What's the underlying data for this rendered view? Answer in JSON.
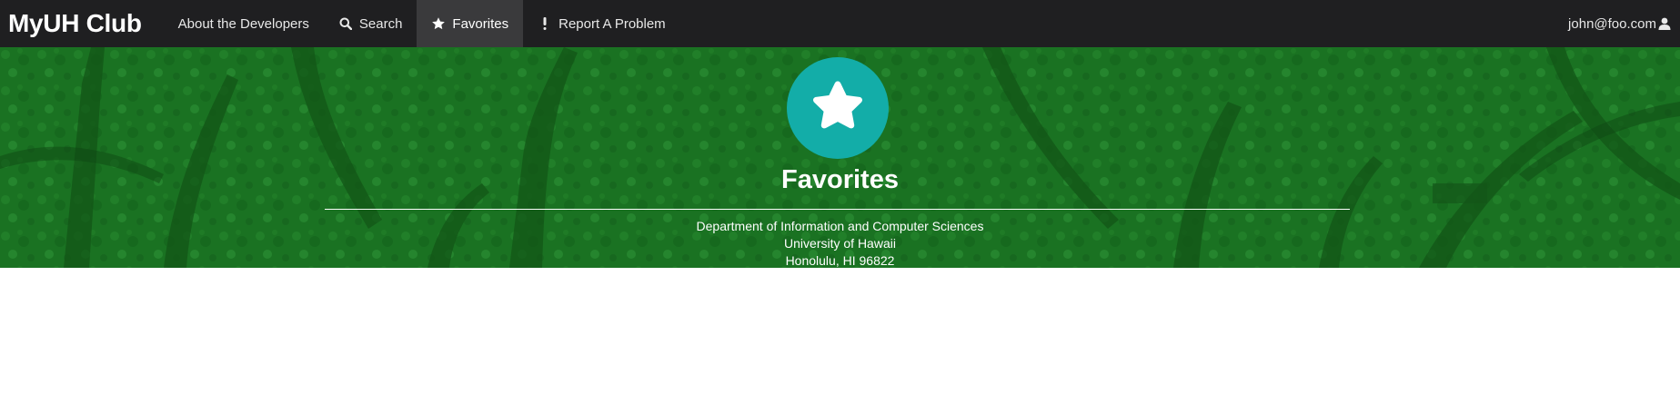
{
  "nav": {
    "brand": "MyUH Club",
    "items": [
      {
        "label": "About the Developers",
        "icon": "",
        "active": false
      },
      {
        "label": "Search",
        "icon": "search-icon",
        "active": false
      },
      {
        "label": "Favorites",
        "icon": "star-icon",
        "active": true
      },
      {
        "label": "Report A Problem",
        "icon": "exclamation-icon",
        "active": false
      }
    ],
    "user": {
      "email": "john@foo.com",
      "icon": "user-icon"
    }
  },
  "hero": {
    "icon": "star-icon",
    "title": "Favorites",
    "address": {
      "line1": "Department of Information and Computer Sciences",
      "line2": "University of Hawaii",
      "line3": "Honolulu, HI 96822"
    }
  },
  "colors": {
    "navbar": "#1f1f21",
    "nav_active": "#3a3a3c",
    "hero_green": "#1e7a26",
    "badge_teal": "#13ada8"
  }
}
